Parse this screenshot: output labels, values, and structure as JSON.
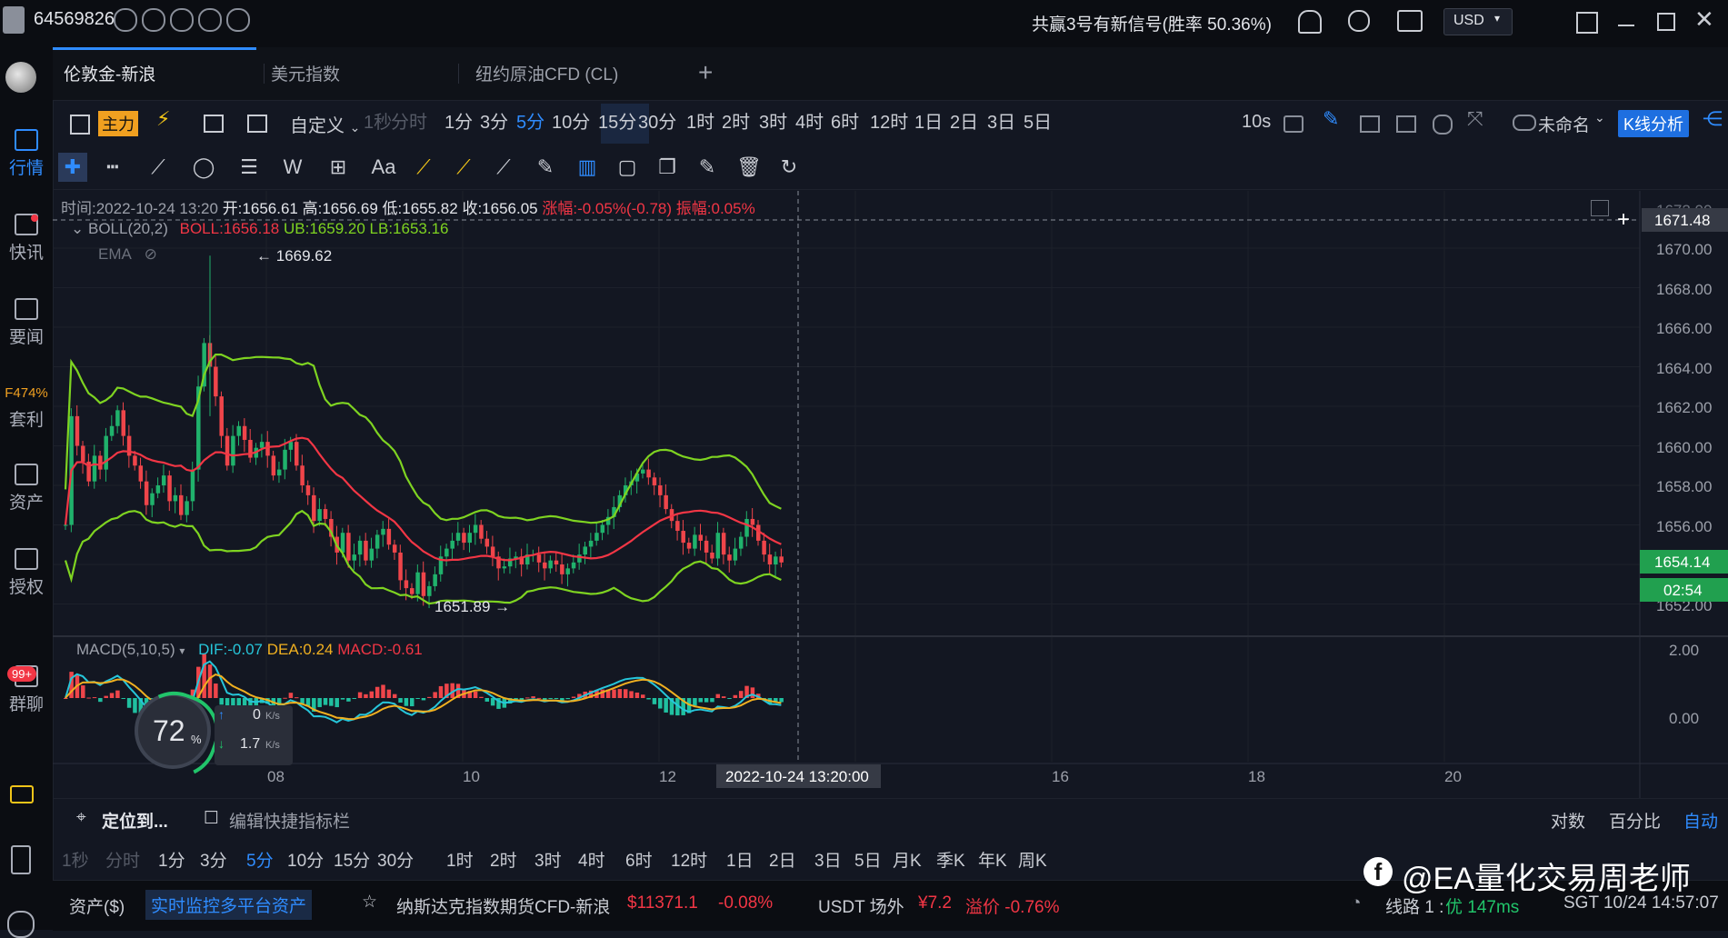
{
  "top": {
    "account_id": "64569826",
    "signal_text": "共赢3号有新信号(胜率 50.36%)",
    "currency": "USD"
  },
  "nav": [
    {
      "label": "行情",
      "icon": "market-icon"
    },
    {
      "label": "快讯",
      "icon": "flash-news-icon"
    },
    {
      "label": "要闻",
      "icon": "news-icon"
    },
    {
      "label": "套利",
      "icon": "arbitrage-icon",
      "badge": "F474%"
    },
    {
      "label": "资产",
      "icon": "assets-icon"
    },
    {
      "label": "授权",
      "icon": "authorize-icon"
    },
    {
      "label": "群聊",
      "icon": "group-chat-icon",
      "badge": "99+"
    }
  ],
  "tabs": [
    "伦敦金-新浪",
    "美元指数",
    "纽约原油CFD (CL)"
  ],
  "toolbar": {
    "main_label": "主力",
    "custom_label": "自定义",
    "timeframes": [
      "1秒",
      "分时",
      "1分",
      "3分",
      "5分",
      "10分",
      "15分",
      "30分",
      "1时",
      "2时",
      "3时",
      "4时",
      "6时",
      "12时",
      "1日",
      "2日",
      "3日",
      "5日"
    ],
    "active_timeframe": "5分",
    "interval": "10s",
    "layout_name": "未命名",
    "kline_button": "K线分析"
  },
  "ohlc": {
    "time": "时间:2022-10-24 13:20",
    "open": "开:1656.61",
    "high": "高:1656.69",
    "low": "低:1655.82",
    "close": "收:1656.05",
    "change": "涨幅:-0.05%(-0.78)",
    "amplitude": "振幅:0.05%"
  },
  "boll": {
    "name": "BOLL(20,2)",
    "boll": "BOLL:1656.18",
    "ub": "UB:1659.20",
    "lb": "LB:1653.16",
    "ema": "EMA"
  },
  "macd": {
    "name": "MACD(5,10,5)",
    "dif": "DIF:-0.07",
    "dea": "DEA:0.24",
    "macd": "MACD:-0.61"
  },
  "chart_data": {
    "type": "candlestick",
    "price_axis": [
      "1670.00",
      "1668.00",
      "1666.00",
      "1664.00",
      "1662.00",
      "1660.00",
      "1658.00",
      "1656.00",
      "1654.00",
      "1652.00"
    ],
    "price_axis_top_partial": "1672.00",
    "macd_axis": [
      "2.00",
      "0.00"
    ],
    "x_labels": [
      "08",
      "10",
      "12",
      "16",
      "18",
      "20"
    ],
    "crosshair_price": "1671.48",
    "crosshair_time": "2022-10-24 13:20:00",
    "last_price": "1654.14",
    "countdown": "02:54",
    "max_label": "1669.62",
    "min_label": "1651.89"
  },
  "gauge": {
    "percent": "72",
    "up_speed": "0",
    "down_speed": "1.7",
    "unit": "K/s"
  },
  "bottom": {
    "locate": "定位到...",
    "edit_bar": "编辑快捷指标栏",
    "scale_log": "对数",
    "scale_pct": "百分比",
    "scale_auto": "自动",
    "timeframes": [
      "1秒",
      "分时",
      "1分",
      "3分",
      "5分",
      "10分",
      "15分",
      "30分",
      "1时",
      "2时",
      "3时",
      "4时",
      "6时",
      "12时",
      "1日",
      "2日",
      "3日",
      "5日",
      "月K",
      "季K",
      "年K",
      "周K"
    ]
  },
  "status": {
    "assets": "资产($)",
    "monitor": "实时监控多平台资产",
    "ticker_name": "纳斯达克指数期货CFD-新浪",
    "ticker_price": "$11371.1",
    "ticker_change": "-0.08%",
    "usdt_label": "USDT 场外",
    "usdt_price": "¥7.2",
    "usdt_premium": "溢价 -0.76%",
    "line_label": "线路 1 :",
    "line_quality": "优 147ms",
    "clock": "SGT  10/24 14:57:07",
    "watermark": "@EA量化交易周老师"
  }
}
